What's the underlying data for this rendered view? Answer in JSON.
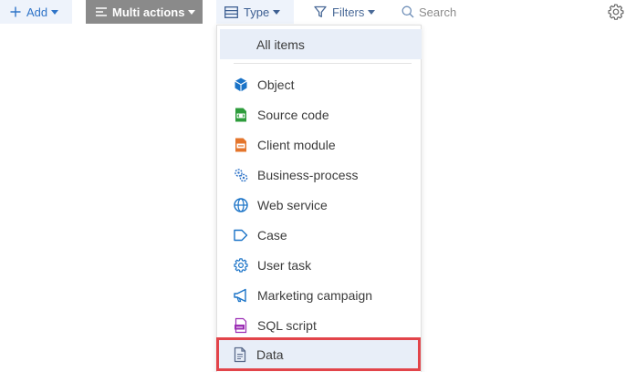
{
  "toolbar": {
    "add_label": "Add",
    "multi_actions_label": "Multi actions",
    "type_label": "Type",
    "filters_label": "Filters",
    "search_placeholder": "Search"
  },
  "dropdown": {
    "all_items_label": "All items",
    "items": [
      {
        "label": "Object",
        "icon": "cube-icon",
        "color": "#1a73c7"
      },
      {
        "label": "Source code",
        "icon": "code-file-icon",
        "color": "#2e9c3c"
      },
      {
        "label": "Client module",
        "icon": "module-file-icon",
        "color": "#e4752b"
      },
      {
        "label": "Business-process",
        "icon": "process-gear-icon",
        "color": "#2f74c8"
      },
      {
        "label": "Web service",
        "icon": "globe-icon",
        "color": "#1a73c7"
      },
      {
        "label": "Case",
        "icon": "case-arrow-icon",
        "color": "#1a73c7"
      },
      {
        "label": "User task",
        "icon": "gear-icon",
        "color": "#1a73c7"
      },
      {
        "label": "Marketing campaign",
        "icon": "megaphone-icon",
        "color": "#1a73c7"
      },
      {
        "label": "SQL script",
        "icon": "sql-file-icon",
        "color": "#9c2fb5"
      },
      {
        "label": "Data",
        "icon": "data-file-icon",
        "color": "#5a6a8a"
      }
    ]
  },
  "colors": {
    "accent": "#2f74c8",
    "highlight_border": "#e2444a",
    "multi_actions_bg": "#8a8a8a",
    "selected_bg": "#e8eef8"
  }
}
